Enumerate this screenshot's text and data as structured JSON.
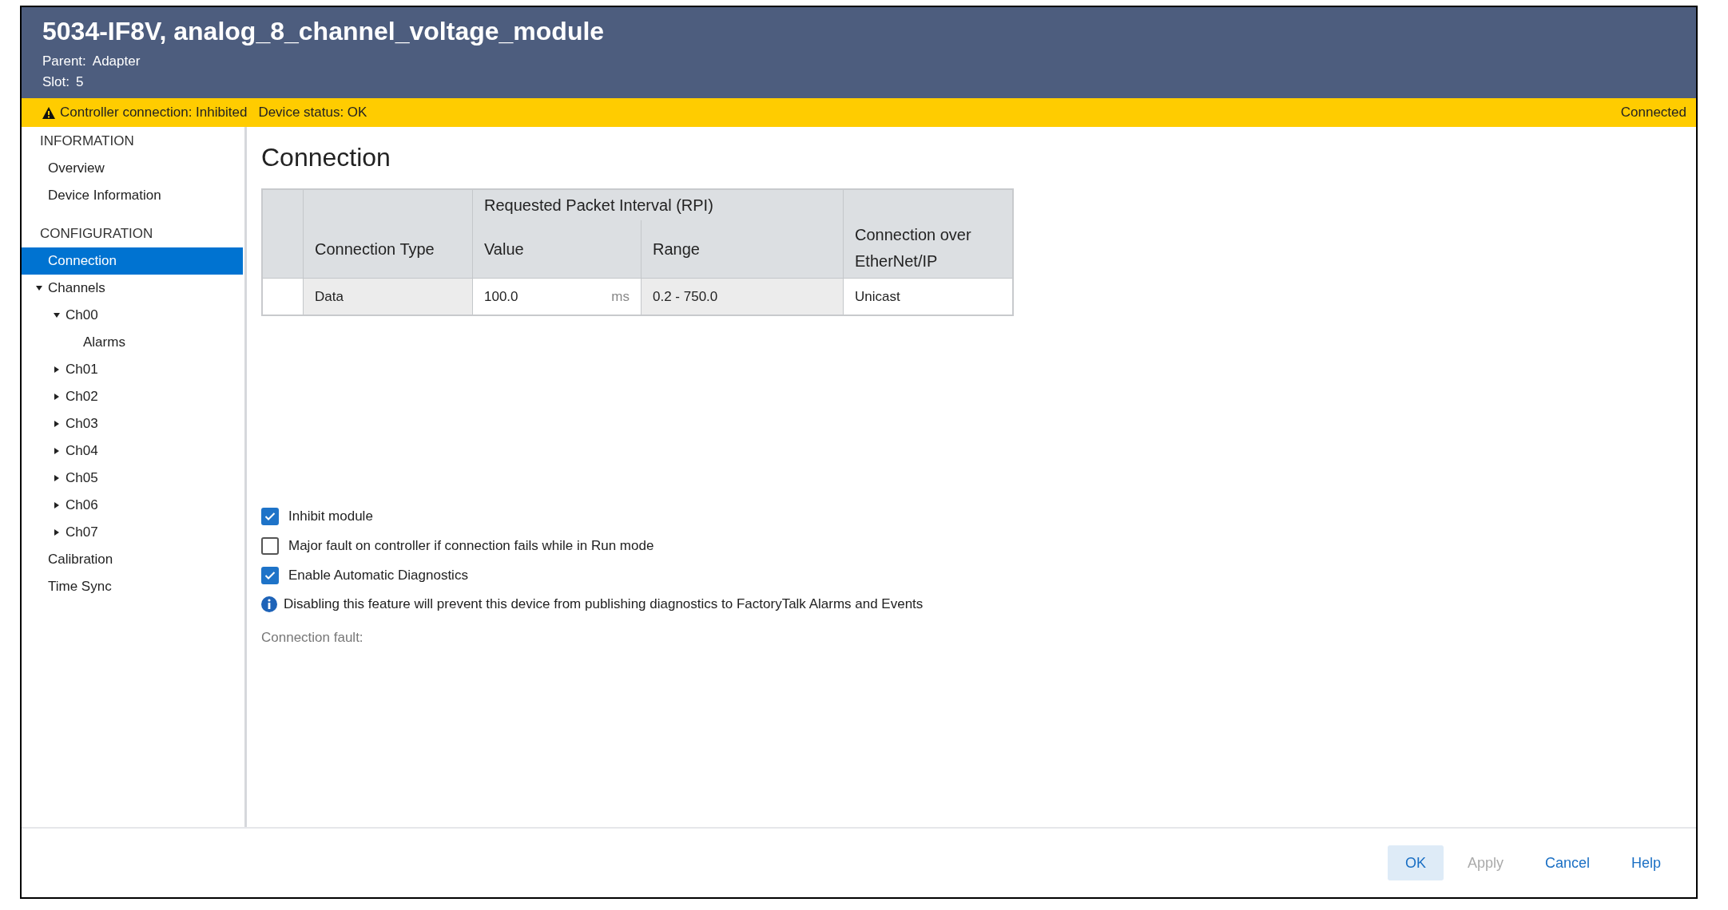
{
  "header": {
    "title": "5034-IF8V, analog_8_channel_voltage_module",
    "parent_label": "Parent:",
    "parent": "Adapter",
    "slot_label": "Slot:",
    "slot": "5"
  },
  "status_bar": {
    "warning": "Controller connection: Inhibited",
    "device_status": "Device status: OK",
    "connection": "Connected"
  },
  "sidebar": {
    "groups": [
      {
        "heading": "INFORMATION",
        "items": [
          {
            "label": "Overview",
            "selected": false
          },
          {
            "label": "Device Information",
            "selected": false
          }
        ]
      },
      {
        "heading": "CONFIGURATION",
        "items": [
          {
            "label": "Connection",
            "selected": true
          },
          {
            "label": "Channels",
            "selected": false,
            "expanded": true,
            "children": [
              {
                "label": "Ch00",
                "selected": false,
                "expanded": true,
                "children": [
                  {
                    "label": "Alarms",
                    "selected": false
                  }
                ]
              },
              {
                "label": "Ch01",
                "selected": false,
                "expanded": false
              },
              {
                "label": "Ch02",
                "selected": false,
                "expanded": false
              },
              {
                "label": "Ch03",
                "selected": false,
                "expanded": false
              },
              {
                "label": "Ch04",
                "selected": false,
                "expanded": false
              },
              {
                "label": "Ch05",
                "selected": false,
                "expanded": false
              },
              {
                "label": "Ch06",
                "selected": false,
                "expanded": false
              },
              {
                "label": "Ch07",
                "selected": false,
                "expanded": false
              }
            ]
          },
          {
            "label": "Calibration",
            "selected": false
          },
          {
            "label": "Time Sync",
            "selected": false
          }
        ]
      }
    ]
  },
  "content": {
    "title": "Connection",
    "table": {
      "group_header": "Requested Packet Interval (RPI)",
      "columns": [
        "Connection Type",
        "Value",
        "Range",
        "Connection over EtherNet/IP"
      ],
      "rows": [
        {
          "type": "Data",
          "value": "100.0",
          "unit": "ms",
          "range": "0.2 - 750.0",
          "connection": "Unicast"
        }
      ]
    },
    "options": [
      {
        "label": "Inhibit module",
        "checked": true
      },
      {
        "label": "Major fault on controller if connection fails while in Run mode",
        "checked": false
      },
      {
        "label": "Enable Automatic Diagnostics",
        "checked": true
      }
    ],
    "info": "Disabling this feature will prevent this device from publishing diagnostics to FactoryTalk Alarms and Events",
    "fault_label": "Connection fault:"
  },
  "buttons": [
    {
      "label": "OK",
      "kind": "default"
    },
    {
      "label": "Apply",
      "kind": "disabled"
    },
    {
      "label": "Cancel",
      "kind": "normal"
    },
    {
      "label": "Help",
      "kind": "normal"
    }
  ]
}
